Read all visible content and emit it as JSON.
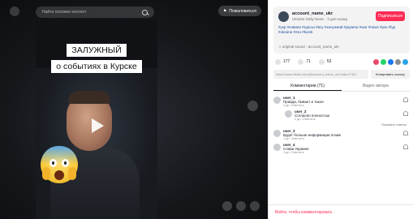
{
  "stage": {
    "search_placeholder": "Найти похожее контент",
    "report_label": "Пожаловаться"
  },
  "video": {
    "title_line1": "ЗАЛУЖНЫЙ",
    "title_line2": "о событиях в Курске"
  },
  "author": {
    "username": "account_name_ukr",
    "subtitle": "Ukraine Daily News · 3 дня назад",
    "follow_label": "Подписаться",
    "description": "#укр #новини #курськ #всу #залужний #україна #war #news #рек #fyp #ukraine #zsu #kursk",
    "music": "♫ original sound - account_name_ukr"
  },
  "stats": {
    "likes": "177",
    "comments": "71",
    "saves": "53"
  },
  "share_colors": [
    "#e64a6a",
    "#25d366",
    "#1877f2",
    "#8a8b91",
    "#2aa3e8"
  ],
  "link": {
    "url": "https://www.tiktok.com/@account_name_ukr/video/7401",
    "copy_label": "Копировать ссылку"
  },
  "tabs": [
    {
      "label": "Комментарии (71)"
    },
    {
      "label": "Видео автора"
    }
  ],
  "comments": [
    {
      "name": "user_1",
      "text": "Правда, бывает и такое",
      "meta": "2 дн.  Ответить"
    },
    {
      "name": "user_2",
      "text": "Согласен полностью",
      "meta": "2 дн.  Ответить"
    },
    {
      "name": "user_3",
      "text": "Будет больше информации позже",
      "meta": "1 дн.  Ответить"
    },
    {
      "name": "user_4",
      "text": "Слава Украине",
      "meta": "1 дн.  Ответить"
    }
  ],
  "more_label": "Показать ответы",
  "footer": {
    "prompt": "Войти, чтобы комментировать"
  }
}
